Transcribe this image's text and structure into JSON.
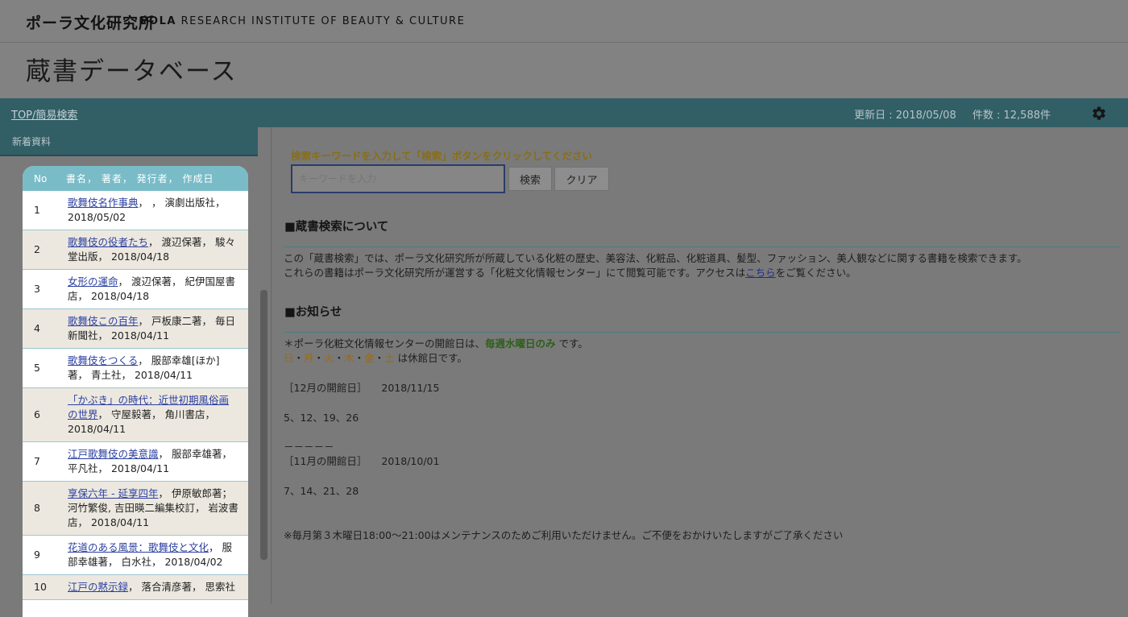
{
  "brand": {
    "name_jp": "ポーラ文化研究所",
    "name_en_bold": "POLA",
    "name_en_rest": "RESEARCH INSTITUTE OF BEAUTY & CULTURE"
  },
  "page_title": "蔵書データベース",
  "nav": {
    "breadcrumb": "TOP/簡易検索",
    "updated": "更新日 : 2018/05/08",
    "count": "件数 : 12,588件",
    "settings_icon": "gear-icon"
  },
  "sidebar": {
    "tab_label": "新着資料",
    "table": {
      "headers": [
        "No",
        "書名， 著者， 発行者， 作成日"
      ],
      "rows": [
        {
          "no": "1",
          "title": "歌舞伎名作事典",
          "rest": "， ， 演劇出版社， 2018/05/02"
        },
        {
          "no": "2",
          "title": "歌舞伎の役者たち",
          "rest": "， 渡辺保著， 駿々堂出版， 2018/04/18"
        },
        {
          "no": "3",
          "title": "女形の運命",
          "rest": "， 渡辺保著， 紀伊国屋書店， 2018/04/18"
        },
        {
          "no": "4",
          "title": "歌舞伎この百年",
          "rest": "， 戸板康二著， 毎日新聞社， 2018/04/11"
        },
        {
          "no": "5",
          "title": "歌舞伎をつくる",
          "rest": "， 服部幸雄[ほか]著， 青土社， 2018/04/11"
        },
        {
          "no": "6",
          "title": "「かぶき」の時代：近世初期風俗画の世界",
          "rest": "， 守屋毅著， 角川書店， 2018/04/11"
        },
        {
          "no": "7",
          "title": "江戸歌舞伎の美意識",
          "rest": "， 服部幸雄著， 平凡社， 2018/04/11"
        },
        {
          "no": "8",
          "title": "享保六年 - 延享四年",
          "rest": "， 伊原敏郎著；河竹繁俊, 吉田暎二編集校訂， 岩波書店， 2018/04/11"
        },
        {
          "no": "9",
          "title": "花道のある風景：歌舞伎と文化",
          "rest": "， 服部幸雄著， 白水社， 2018/04/02"
        },
        {
          "no": "10",
          "title": "江戸の黙示録",
          "rest": "， 落合清彦著， 思索社"
        }
      ]
    }
  },
  "main": {
    "instruction": "検索キーワードを入力して「検索」ボタンをクリックしてください",
    "search": {
      "placeholder": "キーワードを入力",
      "value": ""
    },
    "buttons": {
      "search": "検索",
      "clear": "クリア"
    },
    "about": {
      "heading": "■蔵書検索について",
      "line1": "この「蔵書検索」では、ポーラ文化研究所が所蔵している化粧の歴史、美容法、化粧品、化粧道具、髪型、ファッション、美人観などに関する書籍を検索できます。",
      "line2_pre": "これらの書籍はポーラ文化研究所が運営する「化粧文化情報センター」にて閲覧可能です。アクセスは",
      "line2_link": "こちら",
      "line2_post": "をご覧ください。"
    },
    "news": {
      "heading": "■お知らせ",
      "open_pre": "＊ポーラ化粧文化情報センターの開館日は、",
      "open_days": "毎週水曜日のみ",
      "open_post": " です。",
      "closed_days": [
        "日",
        "月",
        "火",
        "木",
        "金",
        "土"
      ],
      "closed_sep": "・",
      "closed_post": " は休館日です。",
      "dec_label": "［12月の開館日］",
      "dec_date": "2018/11/15",
      "dec_days": "5、12、19、26",
      "divider": "－－－－－",
      "nov_label": "［11月の開館日］",
      "nov_date": "2018/10/01",
      "nov_days": "7、14、21、28",
      "maintenance": "※毎月第３木曜日18:00～21:00はメンテナンスのためご利用いただけません。ご不便をおかけいたしますがご了承ください"
    }
  },
  "colors": {
    "nav_bg": "#325e66",
    "table_header": "#79bcc8",
    "instruction_text": "#8a6e12",
    "highlight_green": "#2e5f1c",
    "link": "#2b3fa0"
  }
}
